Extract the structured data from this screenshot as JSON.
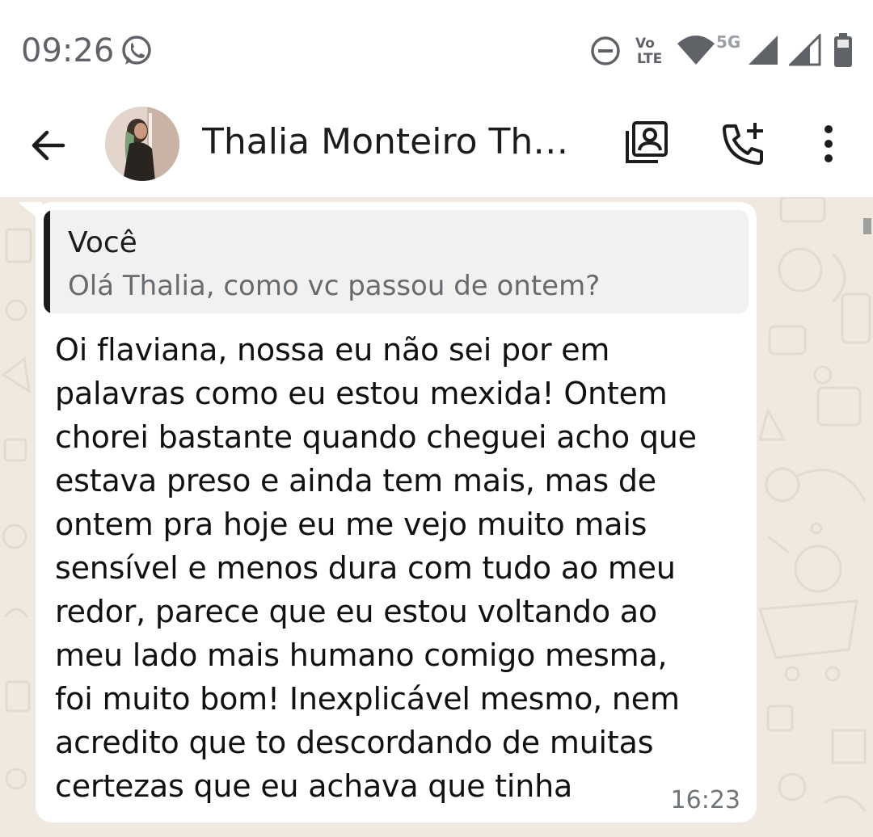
{
  "status_bar": {
    "time": "09:26",
    "network": "5G",
    "volte_top": "Vo",
    "volte_bottom": "LTE",
    "icons": [
      "whatsapp-icon",
      "do-not-disturb-icon",
      "volte-icon",
      "wifi-icon",
      "signal-icon",
      "signal-icon",
      "battery-icon"
    ]
  },
  "header": {
    "contact_name": "Thalia Monteiro Tho...",
    "icons": [
      "back-arrow-icon",
      "contact-card-icon",
      "add-call-icon",
      "more-vert-icon"
    ]
  },
  "message": {
    "quote_author": "Você",
    "quote_text": "Olá Thalia, como vc passou de ontem?",
    "lines": [
      "Oi flaviana, nossa eu não sei por em",
      "palavras como eu estou mexida! Ontem",
      "chorei bastante quando cheguei acho que",
      "estava preso e ainda tem mais, mas de",
      "ontem pra hoje eu me vejo muito mais",
      "sensível e menos dura com tudo ao meu",
      "redor, parece que eu estou voltando ao",
      "meu lado mais humano comigo mesma,",
      "foi muito bom! Inexplicável mesmo, nem",
      "acredito que to descordando de muitas",
      "certezas que eu achava que tinha"
    ],
    "time": "16:23"
  },
  "colors": {
    "chat_background": "#efe9e0",
    "bubble": "#ffffff",
    "quote_background": "#f3f1ef",
    "quote_bar": "#1a1a1a"
  }
}
